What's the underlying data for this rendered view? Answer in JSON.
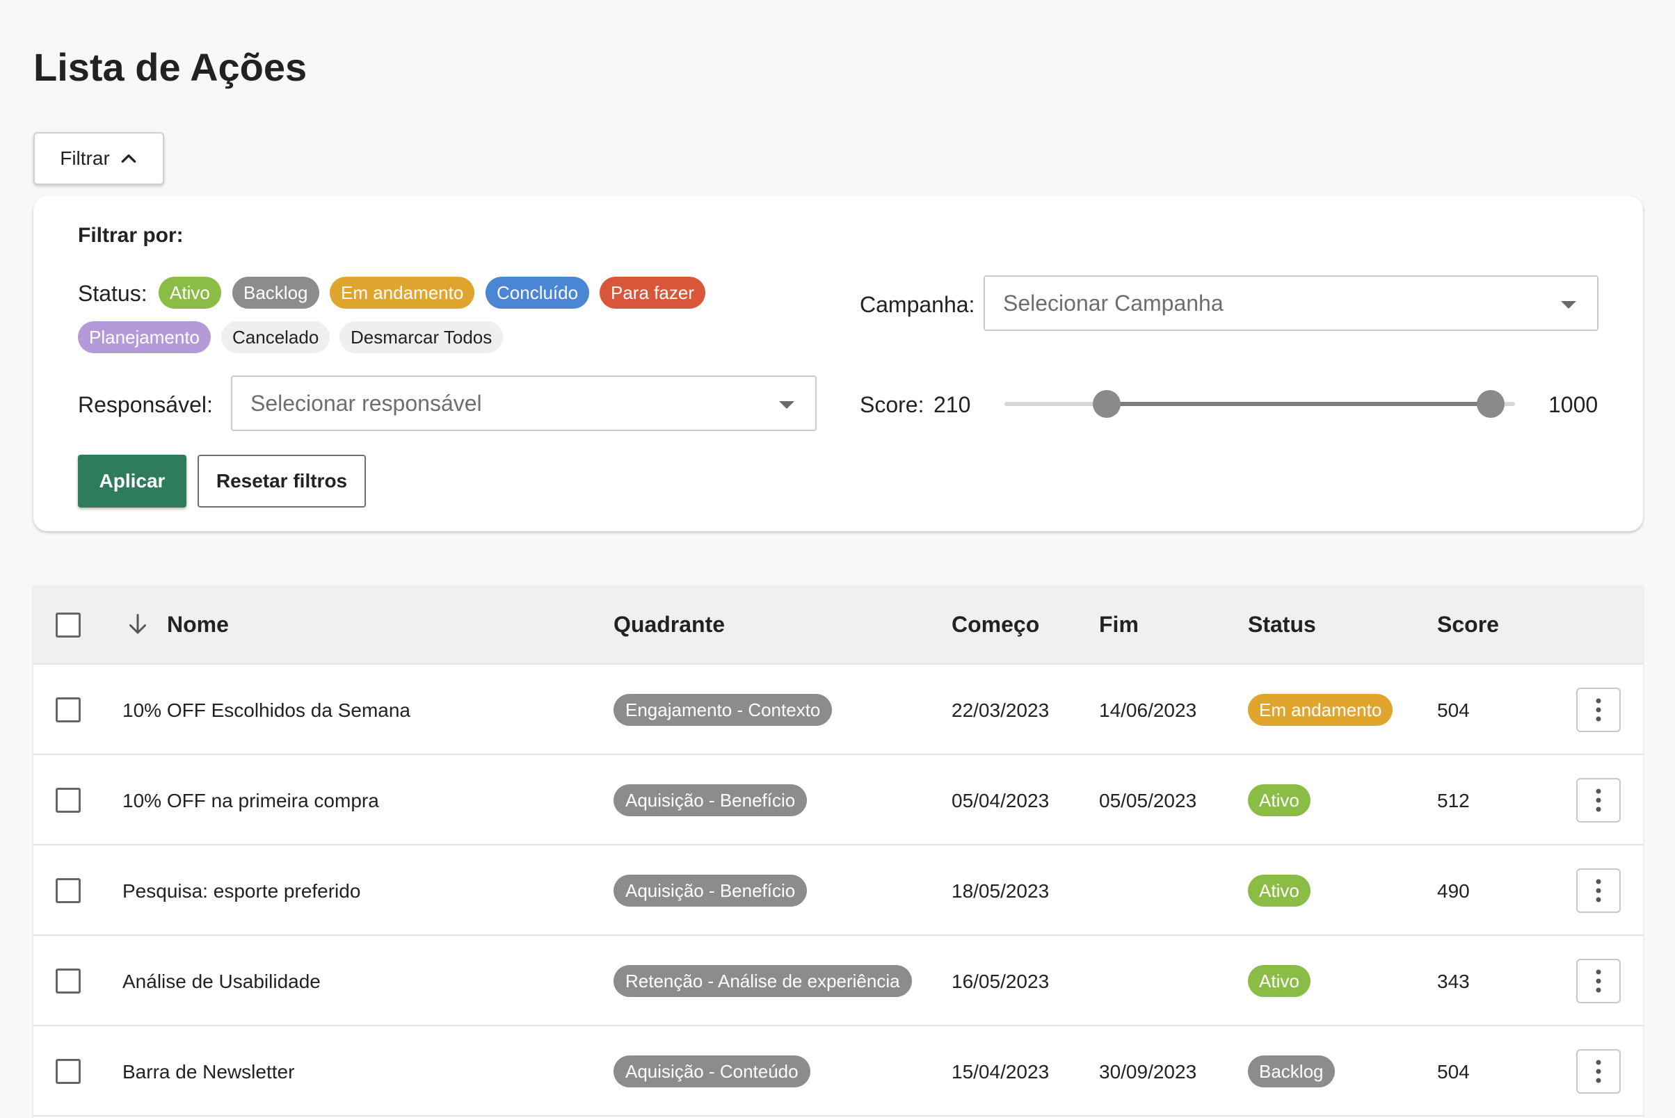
{
  "page": {
    "title": "Lista de Ações"
  },
  "filter": {
    "toggle_label": "Filtrar",
    "heading": "Filtrar por:",
    "status_label": "Status:",
    "chips": [
      {
        "label": "Ativo",
        "color": "#8bbc46",
        "text_color": "#ffffff"
      },
      {
        "label": "Backlog",
        "color": "#8c8c8c",
        "text_color": "#ffffff"
      },
      {
        "label": "Em andamento",
        "color": "#e0a52f",
        "text_color": "#ffffff"
      },
      {
        "label": "Concluído",
        "color": "#4a86d3",
        "text_color": "#ffffff"
      },
      {
        "label": "Para fazer",
        "color": "#d9563a",
        "text_color": "#ffffff"
      },
      {
        "label": "Planejamento",
        "color": "#b49ad8",
        "text_color": "#ffffff"
      },
      {
        "label": "Cancelado",
        "color": "#efefef",
        "text_color": "#222222"
      },
      {
        "label": "Desmarcar Todos",
        "color": "#efefef",
        "text_color": "#222222"
      }
    ],
    "campanha_label": "Campanha:",
    "campanha_placeholder": "Selecionar Campanha",
    "responsavel_label": "Responsável:",
    "responsavel_placeholder": "Selecionar responsável",
    "score_label": "Score:",
    "score_min": "210",
    "score_max": "1000",
    "score_range": [
      210,
      1000
    ],
    "apply_label": "Aplicar",
    "reset_label": "Resetar filtros"
  },
  "table": {
    "headers": {
      "nome": "Nome",
      "quadrante": "Quadrante",
      "comeco": "Começo",
      "fim": "Fim",
      "status": "Status",
      "score": "Score"
    },
    "rows": [
      {
        "nome": "10% OFF Escolhidos da Semana",
        "quadrante": "Engajamento - Contexto",
        "comeco": "22/03/2023",
        "fim": "14/06/2023",
        "status": "Em andamento",
        "status_color": "#e0a52f",
        "score": "504"
      },
      {
        "nome": "10% OFF na primeira compra",
        "quadrante": "Aquisição - Benefício",
        "comeco": "05/04/2023",
        "fim": "05/05/2023",
        "status": "Ativo",
        "status_color": "#8bbc46",
        "score": "512"
      },
      {
        "nome": "Pesquisa: esporte preferido",
        "quadrante": "Aquisição - Benefício",
        "comeco": "18/05/2023",
        "fim": "",
        "status": "Ativo",
        "status_color": "#8bbc46",
        "score": "490"
      },
      {
        "nome": "Análise de Usabilidade",
        "quadrante": "Retenção - Análise de experiência",
        "comeco": "16/05/2023",
        "fim": "",
        "status": "Ativo",
        "status_color": "#8bbc46",
        "score": "343"
      },
      {
        "nome": "Barra de Newsletter",
        "quadrante": "Aquisição - Conteúdo",
        "comeco": "15/04/2023",
        "fim": "30/09/2023",
        "status": "Backlog",
        "status_color": "#8c8c8c",
        "score": "504"
      }
    ]
  }
}
